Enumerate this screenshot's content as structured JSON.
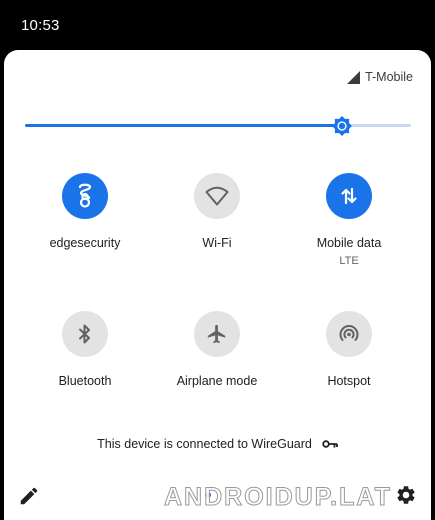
{
  "status_bar": {
    "time": "10:53"
  },
  "carrier": {
    "name": "T-Mobile",
    "icon": "signal-icon"
  },
  "brightness": {
    "level": 0.82,
    "icon": "brightness-icon"
  },
  "tiles": [
    {
      "id": "edgesecurity",
      "label": "edgesecurity",
      "sublabel": "",
      "state": "on",
      "icon": "vpn-app-icon"
    },
    {
      "id": "wifi",
      "label": "Wi-Fi",
      "sublabel": "",
      "state": "off",
      "icon": "wifi-icon"
    },
    {
      "id": "mobile-data",
      "label": "Mobile data",
      "sublabel": "LTE",
      "state": "on",
      "icon": "mobile-data-icon"
    },
    {
      "id": "bluetooth",
      "label": "Bluetooth",
      "sublabel": "",
      "state": "off",
      "icon": "bluetooth-icon"
    },
    {
      "id": "airplane",
      "label": "Airplane mode",
      "sublabel": "",
      "state": "off",
      "icon": "airplane-icon"
    },
    {
      "id": "hotspot",
      "label": "Hotspot",
      "sublabel": "",
      "state": "off",
      "icon": "hotspot-icon"
    }
  ],
  "vpn_status": {
    "text": "This device is connected to WireGuard",
    "icon": "vpn-key-icon"
  },
  "watermark": {
    "text": "ANDROIDUP.LAT"
  },
  "colors": {
    "accent": "#1a73e8",
    "tile_off": "#e3e3e3",
    "icon_off": "#5f6368",
    "panel": "#ffffff"
  }
}
